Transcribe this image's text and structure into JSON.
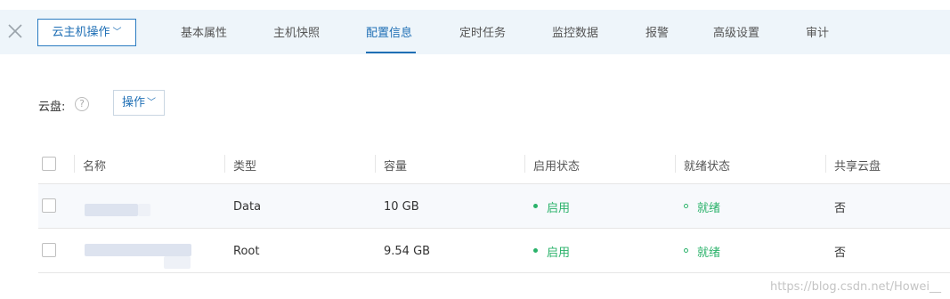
{
  "toolbar": {
    "action_menu_label": "云主机操作"
  },
  "tabs": [
    {
      "label": "基本属性"
    },
    {
      "label": "主机快照"
    },
    {
      "label": "配置信息"
    },
    {
      "label": "定时任务"
    },
    {
      "label": "监控数据"
    },
    {
      "label": "报警"
    },
    {
      "label": "高级设置"
    },
    {
      "label": "审计"
    }
  ],
  "active_tab": "配置信息",
  "disks_section": {
    "label": "云盘:",
    "help_icon_glyph": "?",
    "ops_label": "操作"
  },
  "table": {
    "headers": [
      "名称",
      "类型",
      "容量",
      "启用状态",
      "就绪状态",
      "共享云盘"
    ],
    "rows": [
      {
        "type": "Data",
        "capacity": "10 GB",
        "enable_state": "启用",
        "ready_state": "就绪",
        "shared": "否"
      },
      {
        "type": "Root",
        "capacity": "9.54 GB",
        "enable_state": "启用",
        "ready_state": "就绪",
        "shared": "否"
      }
    ]
  },
  "watermark": "https://blog.csdn.net/Howei__",
  "colors": {
    "accent": "#1f6fb5",
    "topbar_bg": "#eef5fa",
    "status_green": "#2ab26a",
    "row_alt_bg": "#f7f9fc"
  },
  "icons": {
    "close": "close-icon",
    "help": "help-icon",
    "dropdown": "chevron-down-icon",
    "enabled_state": "filled-dot-icon",
    "ready_state": "hollow-dot-icon"
  }
}
